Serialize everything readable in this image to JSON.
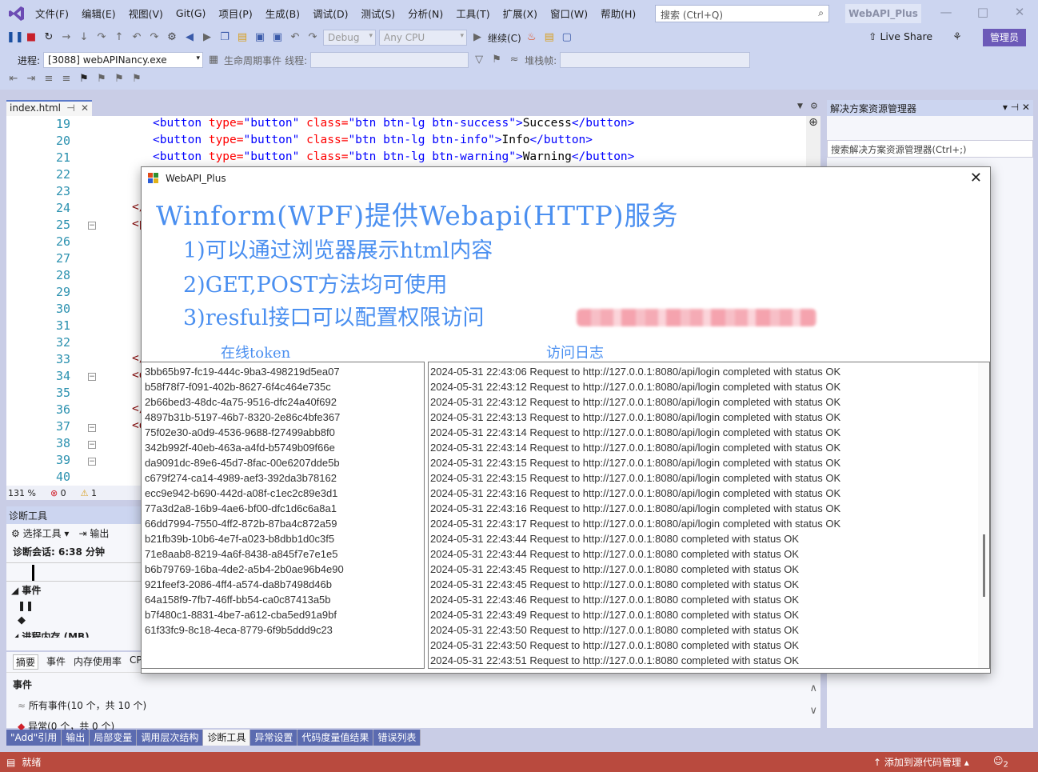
{
  "menu": {
    "items": [
      "文件(F)",
      "编辑(E)",
      "视图(V)",
      "Git(G)",
      "项目(P)",
      "生成(B)",
      "调试(D)",
      "测试(S)",
      "分析(N)",
      "工具(T)",
      "扩展(X)",
      "窗口(W)",
      "帮助(H)"
    ],
    "search_placeholder": "搜索 (Ctrl+Q)",
    "solution_name": "WebAPI_Plus"
  },
  "toolbar": {
    "config": "Debug",
    "platform": "Any CPU",
    "continue": "继续(C)",
    "live_share": "Live Share",
    "admin": "管理员"
  },
  "debug_bar": {
    "process_label": "进程:",
    "process_value": "[3088] webAPINancy.exe",
    "lifecycle": "生命周期事件",
    "thread_label": "线程:",
    "stack_label": "堆栈帧:"
  },
  "editor": {
    "tab": "index.html",
    "line_numbers": [
      "19",
      "20",
      "21",
      "22",
      "23",
      "24",
      "25",
      "26",
      "27",
      "28",
      "29",
      "30",
      "31",
      "32",
      "33",
      "34",
      "35",
      "36",
      "37",
      "38",
      "39",
      "40"
    ],
    "code": [
      {
        "open": "<button",
        "a1": " type=",
        "v1": "\"button\"",
        "a2": " class=",
        "v2": "\"btn btn-lg btn-success\"",
        "text": "Success",
        "close": "</button>"
      },
      {
        "open": "<button",
        "a1": " type=",
        "v1": "\"button\"",
        "a2": " class=",
        "v2": "\"btn btn-lg btn-info\"",
        "text": "Info",
        "close": "</button>"
      },
      {
        "open": "<button",
        "a1": " type=",
        "v1": "\"button\"",
        "a2": " class=",
        "v2": "\"btn btn-lg btn-warning\"",
        "text": "Warning",
        "close": "</button>"
      }
    ],
    "zoom": "131 %",
    "errors": "0",
    "warnings": "1"
  },
  "solution_explorer": {
    "title": "解决方案资源管理器",
    "search_placeholder": "搜索解决方案资源管理器(Ctrl+;)"
  },
  "diagnostics": {
    "title": "诊断工具",
    "select_tool": "选择工具",
    "output": "输出",
    "session": "诊断会话: 6:38 分钟",
    "events_label": "事件",
    "memory_label": "进程内存 (MB)",
    "tabs": [
      "摘要",
      "事件",
      "内存使用率",
      "CP"
    ],
    "events_heading": "事件",
    "all_events": "所有事件(10 个，共 10 个)",
    "exceptions": "异常(0 个，共 0 个)"
  },
  "bottom_tabs": [
    "\"Add\"引用",
    "输出",
    "局部变量",
    "调用层次结构",
    "诊断工具",
    "异常设置",
    "代码度量值结果",
    "错误列表"
  ],
  "status": {
    "ready": "就绪",
    "source_control": "添加到源代码管理",
    "notifications": "2"
  },
  "app_window": {
    "title": "WebAPI_Plus",
    "heading": "Winform(WPF)提供Webapi(HTTP)服务",
    "lines": [
      "1)可以通过浏览器展示html内容",
      "2)GET,POST方法均可使用",
      "3)resful接口可以配置权限访问"
    ],
    "token_label": "在线token",
    "log_label": "访问日志",
    "tokens": [
      "3bb65b97-fc19-444c-9ba3-498219d5ea07",
      "b58f78f7-f091-402b-8627-6f4c464e735c",
      "2b66bed3-48dc-4a75-9516-dfc24a40f692",
      "4897b31b-5197-46b7-8320-2e86c4bfe367",
      "75f02e30-a0d9-4536-9688-f27499abb8f0",
      "342b992f-40eb-463a-a4fd-b5749b09f66e",
      "da9091dc-89e6-45d7-8fac-00e6207dde5b",
      "c679f274-ca14-4989-aef3-392da3b78162",
      "ecc9e942-b690-442d-a08f-c1ec2c89e3d1",
      "77a3d2a8-16b9-4ae6-bf00-dfc1d6c6a8a1",
      "66dd7994-7550-4ff2-872b-87ba4c872a59",
      "b21fb39b-10b6-4e7f-a023-b8dbb1d0c3f5",
      "71e8aab8-8219-4a6f-8438-a845f7e7e1e5",
      "b6b79769-16ba-4de2-a5b4-2b0ae96b4e90",
      "921feef3-2086-4ff4-a574-da8b7498d46b",
      "64a158f9-7fb7-46ff-bb54-ca0c87413a5b",
      "b7f480c1-8831-4be7-a612-cba5ed91a9bf",
      "61f33fc9-8c18-4eca-8779-6f9b5ddd9c23"
    ],
    "logs": [
      "2024-05-31 22:43:06 Request to http://127.0.0.1:8080/api/login completed with status OK",
      "2024-05-31 22:43:12 Request to http://127.0.0.1:8080/api/login completed with status OK",
      "2024-05-31 22:43:12 Request to http://127.0.0.1:8080/api/login completed with status OK",
      "2024-05-31 22:43:13 Request to http://127.0.0.1:8080/api/login completed with status OK",
      "2024-05-31 22:43:14 Request to http://127.0.0.1:8080/api/login completed with status OK",
      "2024-05-31 22:43:14 Request to http://127.0.0.1:8080/api/login completed with status OK",
      "2024-05-31 22:43:15 Request to http://127.0.0.1:8080/api/login completed with status OK",
      "2024-05-31 22:43:15 Request to http://127.0.0.1:8080/api/login completed with status OK",
      "2024-05-31 22:43:16 Request to http://127.0.0.1:8080/api/login completed with status OK",
      "2024-05-31 22:43:16 Request to http://127.0.0.1:8080/api/login completed with status OK",
      "2024-05-31 22:43:17 Request to http://127.0.0.1:8080/api/login completed with status OK",
      "2024-05-31 22:43:44 Request to http://127.0.0.1:8080 completed with status OK",
      "2024-05-31 22:43:44 Request to http://127.0.0.1:8080 completed with status OK",
      "2024-05-31 22:43:45 Request to http://127.0.0.1:8080 completed with status OK",
      "2024-05-31 22:43:45 Request to http://127.0.0.1:8080 completed with status OK",
      "2024-05-31 22:43:46 Request to http://127.0.0.1:8080 completed with status OK",
      "2024-05-31 22:43:49 Request to http://127.0.0.1:8080 completed with status OK",
      "2024-05-31 22:43:50 Request to http://127.0.0.1:8080 completed with status OK",
      "2024-05-31 22:43:50 Request to http://127.0.0.1:8080 completed with status OK",
      "2024-05-31 22:43:51 Request to http://127.0.0.1:8080 completed with status OK"
    ]
  },
  "colors": {
    "heading_blue": "#4a8ff0",
    "status_bar": "#b94a3e",
    "admin_purple": "#6c5ab8"
  }
}
